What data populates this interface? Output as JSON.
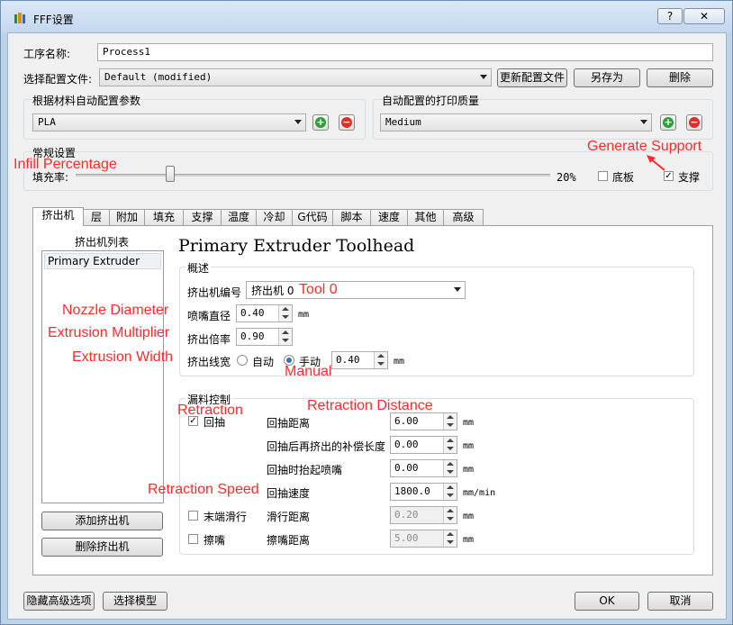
{
  "window": {
    "title": "FFF设置",
    "help_btn": "?",
    "close_btn": "✕"
  },
  "process": {
    "label": "工序名称:",
    "value": "Process1"
  },
  "config": {
    "label": "选择配置文件:",
    "selected": "Default (modified)",
    "update_btn": "更新配置文件",
    "saveas_btn": "另存为",
    "delete_btn": "删除"
  },
  "auto_material": {
    "label": "根据材料自动配置参数",
    "selected": "PLA"
  },
  "auto_quality": {
    "label": "自动配置的打印质量",
    "selected": "Medium"
  },
  "general": {
    "label": "常规设置",
    "infill_label": "填充率:",
    "infill_value": "20%",
    "infill_fraction": 0.2,
    "raft_label": "底板",
    "raft_checked": false,
    "support_label": "支撑",
    "support_checked": true
  },
  "tabs": [
    "挤出机",
    "层",
    "附加",
    "填充",
    "支撑",
    "温度",
    "冷却",
    "G代码",
    "脚本",
    "速度",
    "其他",
    "高级"
  ],
  "active_tab": "挤出机",
  "extruder_list": {
    "title": "挤出机列表",
    "items": [
      "Primary Extruder"
    ],
    "add_btn": "添加挤出机",
    "remove_btn": "删除挤出机"
  },
  "heading": "Primary Extruder Toolhead",
  "overview": {
    "label": "概述",
    "tool_label": "挤出机编号",
    "tool_value": "挤出机 0",
    "nozzle_label": "喷嘴直径",
    "nozzle_value": "0.40",
    "nozzle_unit": "mm",
    "mult_label": "挤出倍率",
    "mult_value": "0.90",
    "width_label": "挤出线宽",
    "width_auto": "自动",
    "width_manual": "手动",
    "width_value": "0.40",
    "width_unit": "mm"
  },
  "ooze": {
    "label": "漏料控制",
    "retraction_label": "回抽",
    "retraction_checked": true,
    "dist_label": "回抽距离",
    "dist_value": "6.00",
    "dist_unit": "mm",
    "extra_label": "回抽后再挤出的补偿长度",
    "extra_value": "0.00",
    "extra_unit": "mm",
    "lift_label": "回抽时抬起喷嘴",
    "lift_value": "0.00",
    "lift_unit": "mm",
    "speed_label": "回抽速度",
    "speed_value": "1800.0",
    "speed_unit": "mm/min",
    "coast_label": "末端滑行",
    "coast_checked": false,
    "coast_dist_label": "滑行距离",
    "coast_value": "0.20",
    "coast_unit": "mm",
    "wipe_label": "擦嘴",
    "wipe_checked": false,
    "wipe_dist_label": "擦嘴距离",
    "wipe_value": "5.00",
    "wipe_unit": "mm"
  },
  "footer": {
    "hide_btn": "隐藏高级选项",
    "select_btn": "选择模型",
    "ok_btn": "OK",
    "cancel_btn": "取消"
  },
  "annotations": {
    "generate_support": "Generate Support",
    "infill_percentage": "Infill Percentage",
    "tool0": "Tool 0",
    "nozzle_diameter": "Nozzle Diameter",
    "extrusion_multiplier": "Extrusion Multiplier",
    "extrusion_width": "Extrusion Width",
    "manual": "Manual",
    "retraction": "Retraction",
    "retraction_distance": "Retraction Distance",
    "retraction_speed": "Retraction Speed"
  },
  "colors": {
    "annotation": "#ff2b2b",
    "plus_green": "#2f9e3a",
    "minus_red": "#d9302a"
  }
}
